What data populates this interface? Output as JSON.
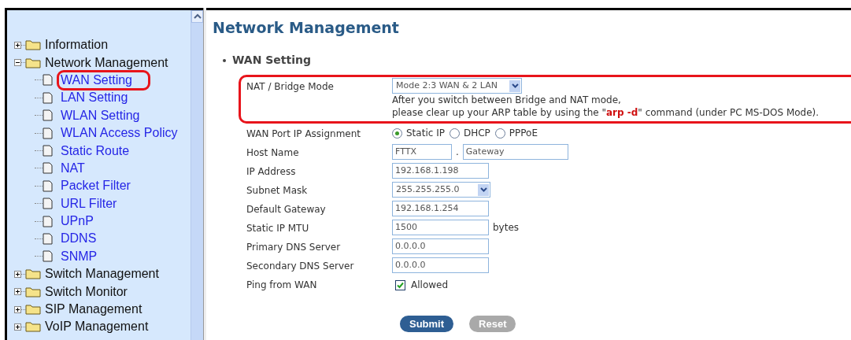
{
  "sidebar": {
    "items": [
      {
        "label": "Information",
        "kind": "folder",
        "expanded": false,
        "selected": false
      },
      {
        "label": "Network Management",
        "kind": "folder",
        "expanded": true,
        "selected": false,
        "children": [
          {
            "label": "WAN Setting",
            "kind": "page",
            "selected": true
          },
          {
            "label": "LAN Setting",
            "kind": "page",
            "selected": false
          },
          {
            "label": "WLAN Setting",
            "kind": "page",
            "selected": false
          },
          {
            "label": "WLAN Access Policy",
            "kind": "page",
            "selected": false
          },
          {
            "label": "Static Route",
            "kind": "page",
            "selected": false
          },
          {
            "label": "NAT",
            "kind": "page",
            "selected": false
          },
          {
            "label": "Packet Filter",
            "kind": "page",
            "selected": false
          },
          {
            "label": "URL Filter",
            "kind": "page",
            "selected": false
          },
          {
            "label": "UPnP",
            "kind": "page",
            "selected": false
          },
          {
            "label": "DDNS",
            "kind": "page",
            "selected": false
          },
          {
            "label": "SNMP",
            "kind": "page",
            "selected": false
          }
        ]
      },
      {
        "label": "Switch Management",
        "kind": "folder",
        "expanded": false,
        "selected": false
      },
      {
        "label": "Switch Monitor",
        "kind": "folder",
        "expanded": false,
        "selected": false
      },
      {
        "label": "SIP Management",
        "kind": "folder",
        "expanded": false,
        "selected": false
      },
      {
        "label": "VoIP Management",
        "kind": "folder",
        "expanded": false,
        "selected": false
      }
    ]
  },
  "page_title": "Network Management",
  "section_title": "WAN Setting",
  "form": {
    "highlighted": true,
    "rows": [
      {
        "kind": "select",
        "label": "NAT / Bridge Mode",
        "value": "Mode 2:3 WAN & 2 LAN",
        "notes": [
          "After you switch between Bridge and NAT mode,",
          "please clear up your ARP table by using the \"**arp -d**\" command (under PC MS-DOS Mode)."
        ]
      },
      {
        "kind": "radio",
        "label": "WAN Port IP Assignment",
        "options": [
          {
            "label": "Static IP",
            "selected": true
          },
          {
            "label": "DHCP",
            "selected": false
          },
          {
            "label": "PPPoE",
            "selected": false
          }
        ]
      },
      {
        "kind": "host",
        "label": "Host Name",
        "value": "FTTX",
        "separator": ".",
        "value_2": "Gateway"
      },
      {
        "kind": "text",
        "label": "IP Address",
        "value": "192.168.1.198"
      },
      {
        "kind": "select",
        "label": "Subnet Mask",
        "value": "255.255.255.0"
      },
      {
        "kind": "text",
        "label": "Default Gateway",
        "value": "192.168.1.254"
      },
      {
        "kind": "text",
        "label": "Static IP MTU",
        "value": "1500",
        "unit": "bytes"
      },
      {
        "kind": "text",
        "label": "Primary DNS Server",
        "value": "0.0.0.0"
      },
      {
        "kind": "text",
        "label": "Secondary DNS Server",
        "value": "0.0.0.0"
      },
      {
        "kind": "checkbox",
        "label": "Ping from WAN",
        "option": "Allowed",
        "checked": true
      }
    ]
  },
  "buttons": [
    {
      "label": "Submit",
      "disabled": false
    },
    {
      "label": "Reset",
      "disabled": true
    }
  ]
}
